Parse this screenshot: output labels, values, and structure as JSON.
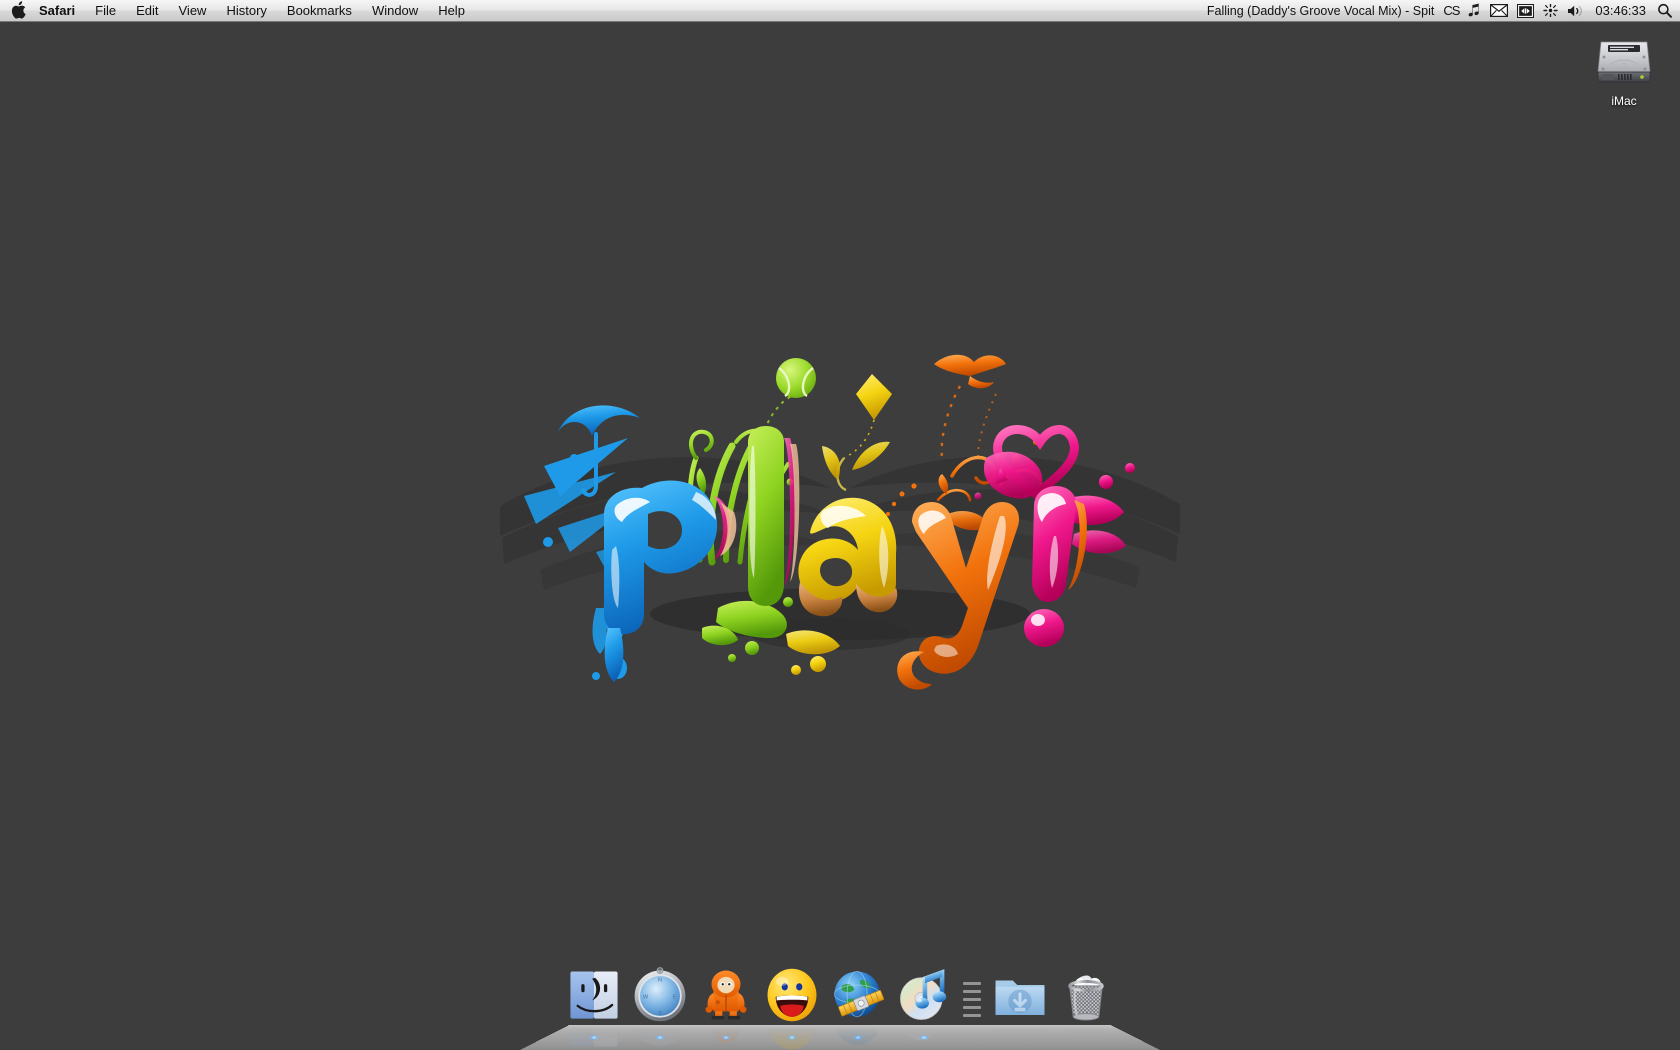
{
  "menubar": {
    "apple_icon": "apple-logo-icon",
    "items": [
      {
        "label": "Safari",
        "bold": true
      },
      {
        "label": "File",
        "bold": false
      },
      {
        "label": "Edit",
        "bold": false
      },
      {
        "label": "View",
        "bold": false
      },
      {
        "label": "History",
        "bold": false
      },
      {
        "label": "Bookmarks",
        "bold": false
      },
      {
        "label": "Window",
        "bold": false
      },
      {
        "label": "Help",
        "bold": false
      }
    ],
    "status": {
      "now_playing": "Falling (Daddy's Groove Vocal Mix) - Spit",
      "cs_label": "CS",
      "music_icon": "music-note-icon",
      "mail_icon": "envelope-icon",
      "display_icon": "display-mirroring-icon",
      "bluetooth_icon": "airport-icon",
      "volume_icon": "volume-icon",
      "clock": "03:46:33",
      "spotlight_icon": "search-icon"
    }
  },
  "desktop": {
    "drive": {
      "label": "iMac",
      "icon": "hard-drive-icon"
    },
    "wallpaper": {
      "word": "Play!",
      "description": "colorful 3d glossy typography with splashes",
      "elements": [
        "tennis-ball",
        "kite",
        "bird",
        "umbrella",
        "heart",
        "grass-swirls"
      ],
      "colors": {
        "background": "#3d3d3d",
        "blue": "#1e9ae8",
        "green": "#8fd321",
        "yellow": "#f5d412",
        "orange": "#f2720c",
        "pink": "#f0188c",
        "magenta": "#e8147e"
      }
    }
  },
  "dock": {
    "items": [
      {
        "label": "Finder",
        "icon": "finder-icon",
        "running": true
      },
      {
        "label": "Safari",
        "icon": "safari-icon",
        "running": true
      },
      {
        "label": "Kenny",
        "icon": "kenny-icon",
        "running": true
      },
      {
        "label": "Yahoo Messenger",
        "icon": "yahoo-messenger-icon",
        "running": true
      },
      {
        "label": "Transmit",
        "icon": "globe-satellite-icon",
        "running": true
      },
      {
        "label": "iTunes",
        "icon": "itunes-icon",
        "running": true
      }
    ],
    "separator": "dock-separator",
    "stacks": [
      {
        "label": "Downloads",
        "icon": "downloads-folder-icon"
      },
      {
        "label": "Trash",
        "icon": "trash-full-icon"
      }
    ]
  }
}
